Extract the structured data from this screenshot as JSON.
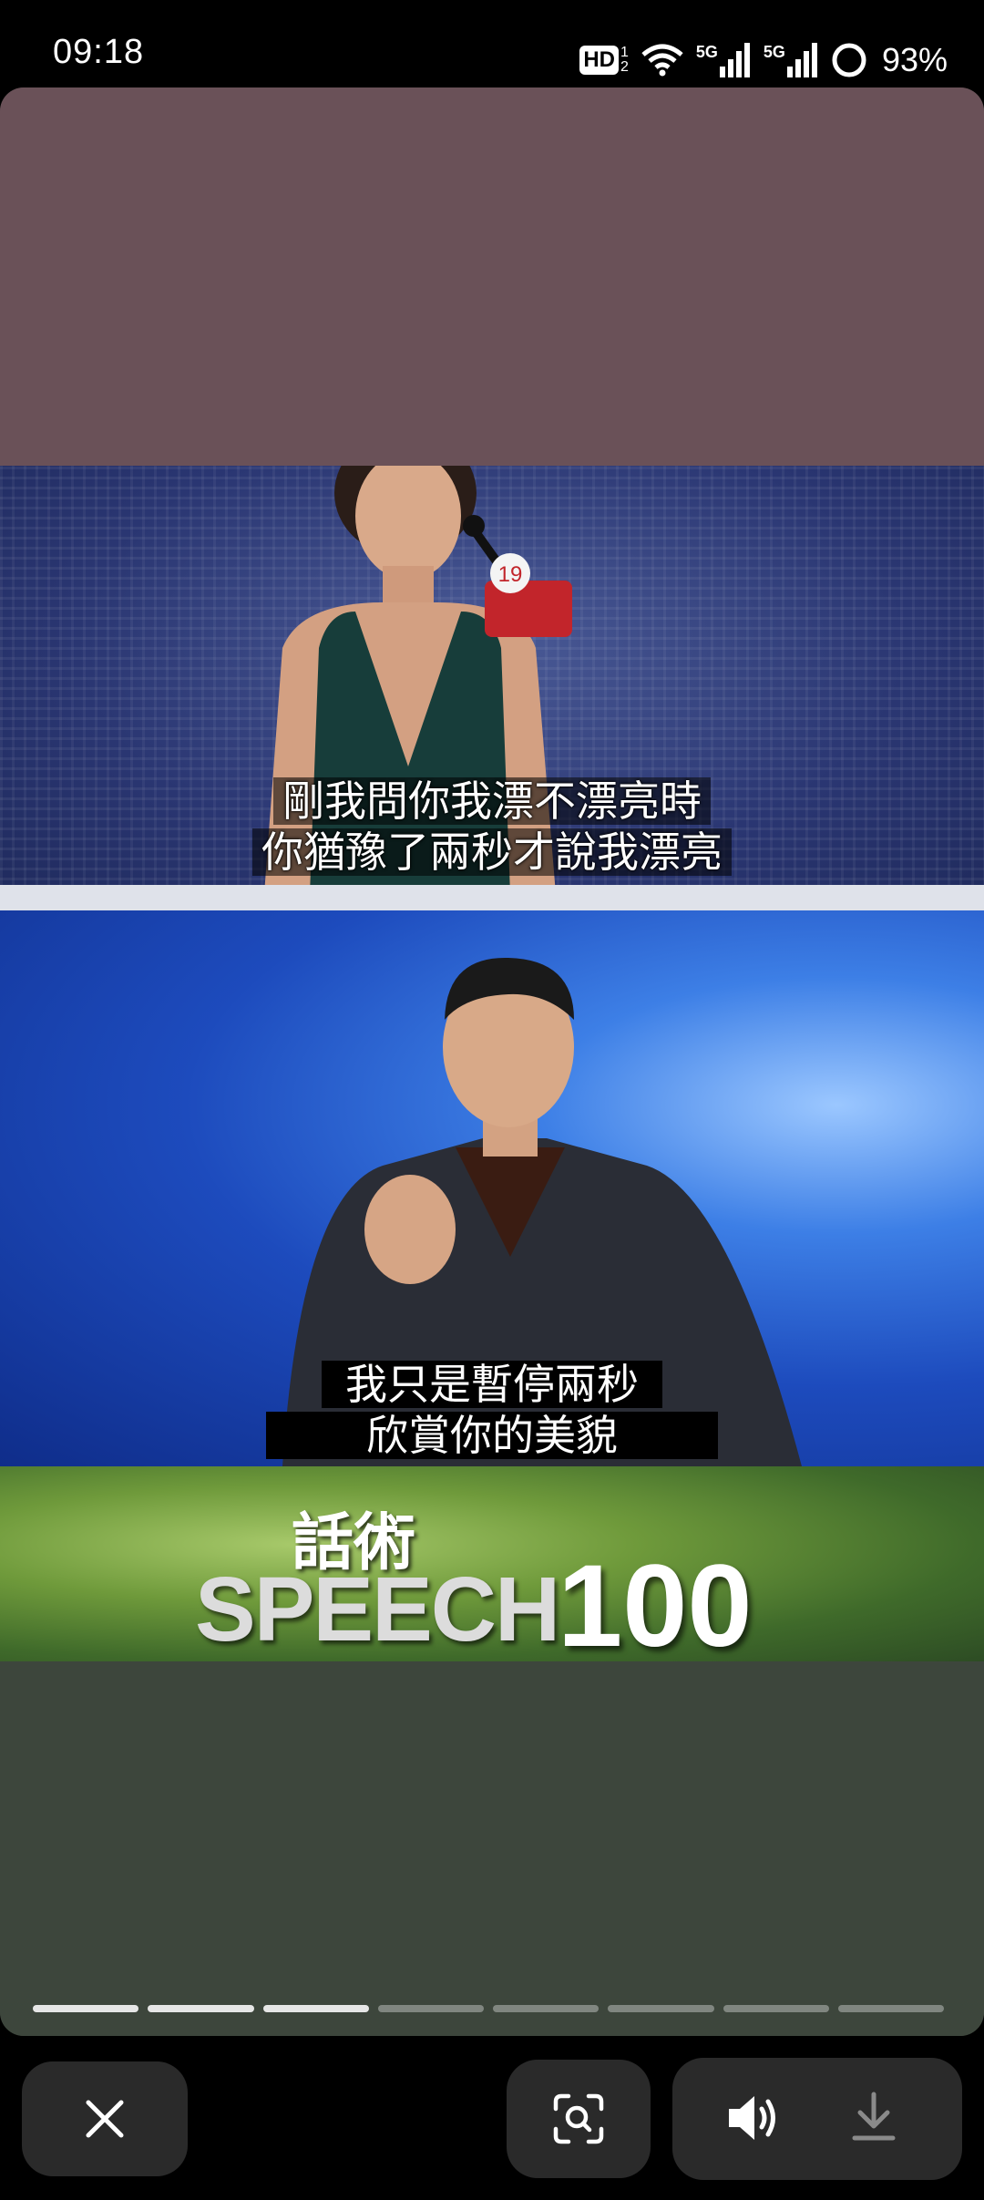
{
  "status_bar": {
    "time": "09:18",
    "hd_label": "HD",
    "sim1_label": "5G",
    "sim2_label": "5G",
    "battery": "93%"
  },
  "story": {
    "progress": {
      "total_segments": 8,
      "completed_segments": 3
    },
    "subtitles": {
      "scene_a_line1": "剛我問你我漂不漂亮時",
      "scene_a_line2": "你猶豫了兩秒才說我漂亮",
      "scene_b_line1": "我只是暫停兩秒",
      "scene_b_line2": "欣賞你的美貌"
    },
    "badge_number": "19",
    "brand_cn": "話術",
    "brand_en": "SPEECH",
    "brand_number": "100"
  },
  "bottom_bar": {
    "close_icon": "close-icon",
    "lens_icon": "scan-icon",
    "sound_icon": "volume-icon",
    "download_icon": "download-icon"
  },
  "colors": {
    "top_band": "#6a5158",
    "bottom_band": "#3d463c",
    "button_bg": "#2a2a2a"
  }
}
